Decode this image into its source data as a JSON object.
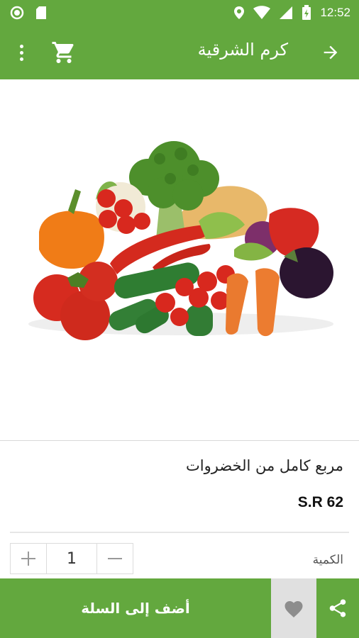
{
  "status_bar": {
    "time": "12:52",
    "icons": [
      "circle-icon",
      "sd-card-icon",
      "location-icon",
      "wifi-icon",
      "signal-icon",
      "battery-charging-icon"
    ]
  },
  "app_bar": {
    "title": "كرم الشرقية",
    "icons": [
      "more-vertical-icon",
      "cart-icon",
      "arrow-forward-icon"
    ]
  },
  "product": {
    "image": "vegetables-image",
    "name": "مربع كامل من الخضروات",
    "price": "S.R 62"
  },
  "quantity": {
    "label": "الكمية",
    "value": "1",
    "minus_icon": "minus-icon",
    "plus_icon": "plus-icon"
  },
  "actions": {
    "add_to_cart": "أضف إلى السلة",
    "favorite_icon": "heart-icon",
    "share_icon": "share-icon"
  },
  "colors": {
    "primary": "#63a83e",
    "favorite_bg": "#e0e0e0"
  }
}
